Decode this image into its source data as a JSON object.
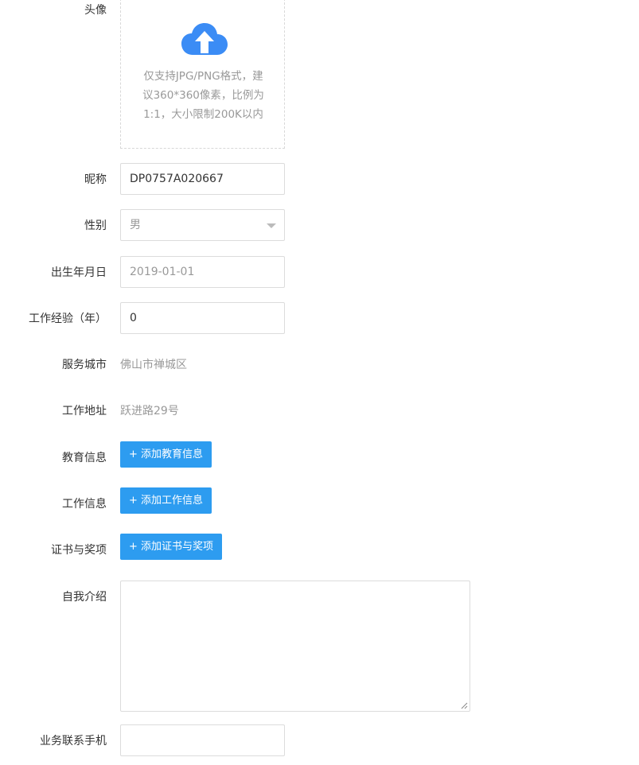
{
  "avatar": {
    "label": "头像",
    "hint": "仅支持JPG/PNG格式，建议360*360像素，比例为1:1，大小限制200K以内",
    "icon": "cloud-upload-icon",
    "icon_color": "#3b8cf5"
  },
  "nickname": {
    "label": "昵称",
    "value": "DP0757A020667"
  },
  "gender": {
    "label": "性别",
    "value": "男",
    "icon": "chevron-down-icon"
  },
  "birthday": {
    "label": "出生年月日",
    "value": "2019-01-01"
  },
  "experience": {
    "label": "工作经验（年）",
    "value": "0"
  },
  "service_city": {
    "label": "服务城市",
    "value": "佛山市禅城区"
  },
  "work_address": {
    "label": "工作地址",
    "value": "跃进路29号"
  },
  "education": {
    "label": "教育信息",
    "button": "+ 添加教育信息"
  },
  "work_info": {
    "label": "工作信息",
    "button": "+ 添加工作信息"
  },
  "certificates": {
    "label": "证书与奖项",
    "button": "+ 添加证书与奖项"
  },
  "intro": {
    "label": "自我介绍",
    "value": ""
  },
  "phone": {
    "label": "业务联系手机",
    "value": ""
  },
  "colors": {
    "primary_button": "#2d9cf0",
    "muted_text": "#999999",
    "border": "#dcdcdc"
  }
}
